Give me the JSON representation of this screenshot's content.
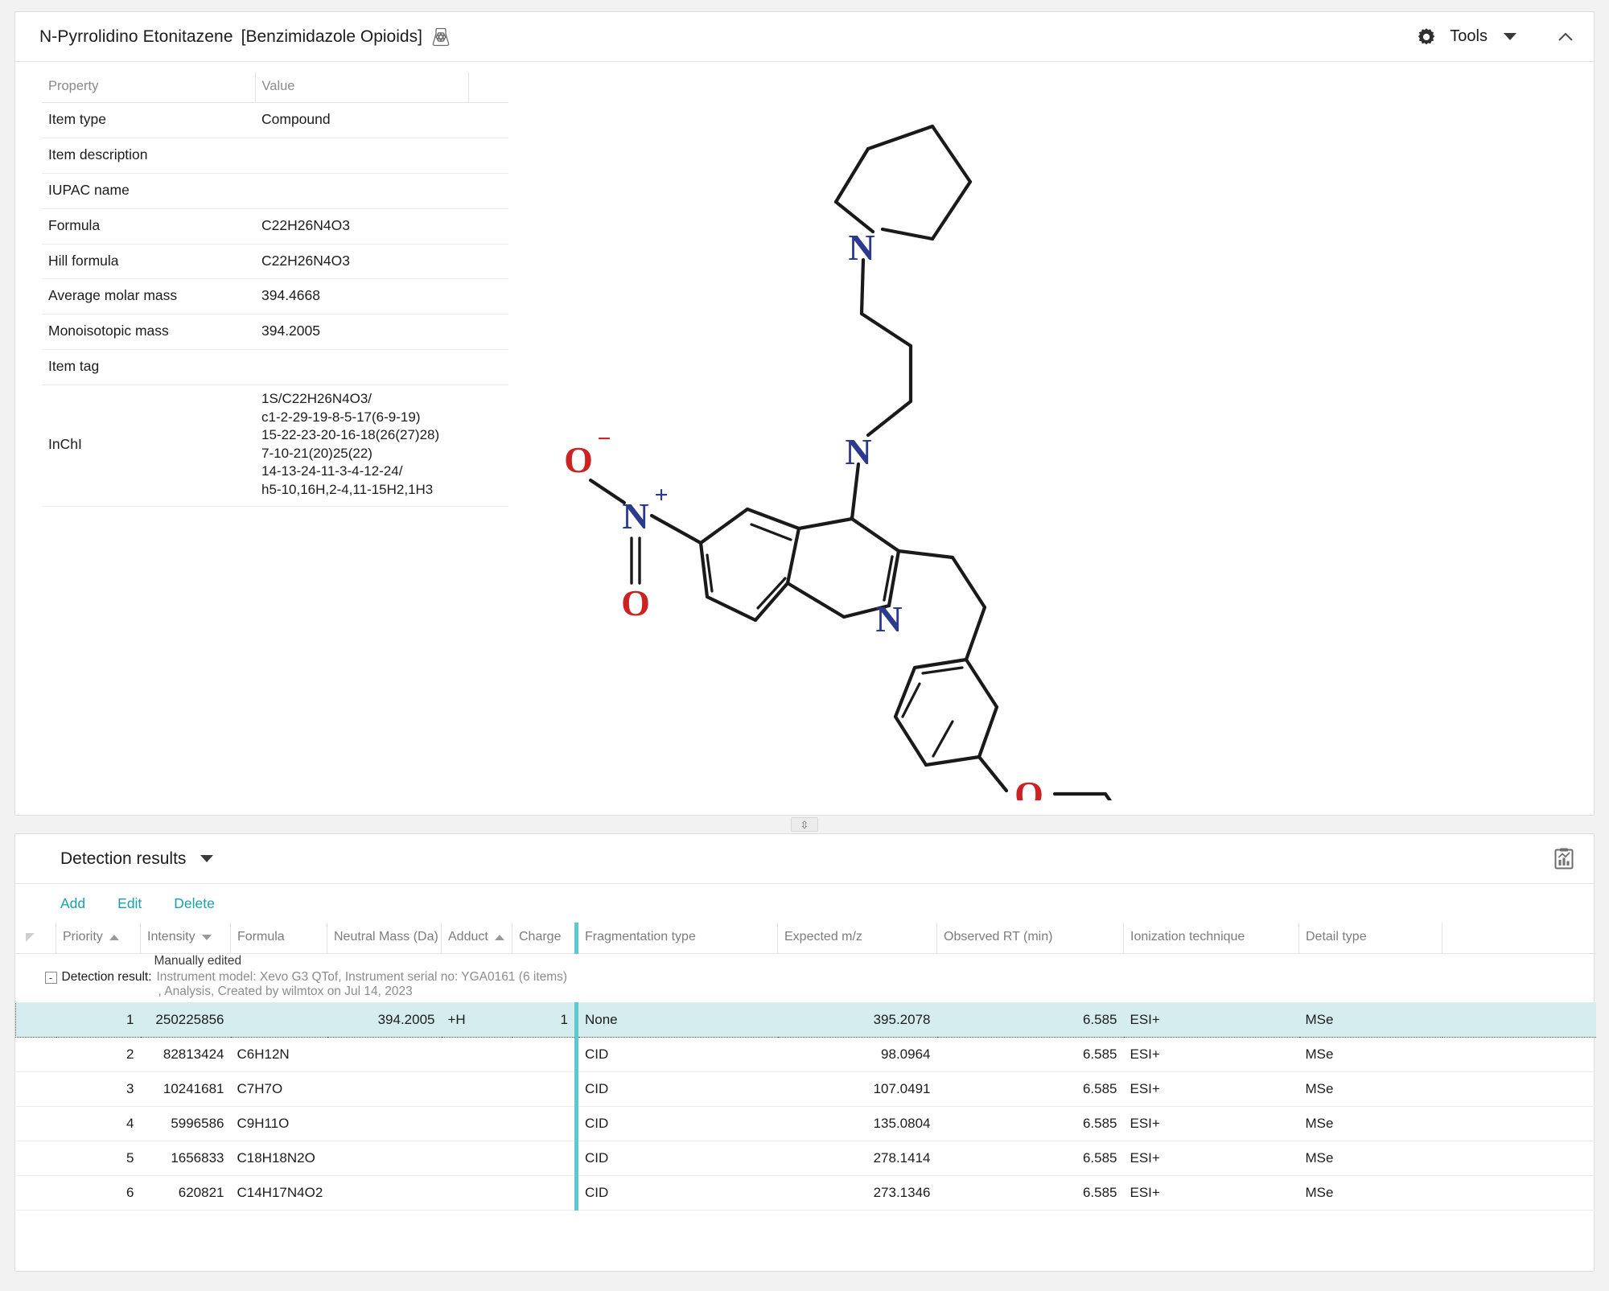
{
  "compound": {
    "name": "N-Pyrrolidino Etonitazene",
    "category": "[Benzimidazole Opioids]",
    "flask_icon": "molecule-flask-icon"
  },
  "top_toolbar": {
    "gear_icon": "gear-icon",
    "tools_label": "Tools",
    "caret_icon": "chevron-down-icon",
    "collapse_icon": "chevron-up-icon"
  },
  "properties": {
    "headers": [
      "Property",
      "Value",
      ""
    ],
    "rows": [
      {
        "property": "Item type",
        "value": "Compound"
      },
      {
        "property": "Item description",
        "value": ""
      },
      {
        "property": "IUPAC name",
        "value": ""
      },
      {
        "property": "Formula",
        "value": "C22H26N4O3"
      },
      {
        "property": "Hill formula",
        "value": "C22H26N4O3"
      },
      {
        "property": "Average molar mass",
        "value": "394.4668"
      },
      {
        "property": "Monoisotopic mass",
        "value": "394.2005"
      },
      {
        "property": "Item tag",
        "value": ""
      },
      {
        "property": "InChI",
        "value": "1S/C22H26N4O3/\nc1-2-29-19-8-5-17(6-9-19)\n15-22-23-20-16-18(26(27)28)\n7-10-21(20)25(22)\n14-13-24-11-3-4-12-24/\nh5-10,16H,2-4,11-15H2,1H3"
      }
    ]
  },
  "structure": {
    "atom_labels": [
      "N",
      "N",
      "N",
      "O",
      "O",
      "O"
    ],
    "charges": [
      "-",
      "+"
    ],
    "nitrogen_color": "#2b3a8f",
    "oxygen_color": "#cc2222",
    "bond_color": "#1a1a1a"
  },
  "splitter": {
    "handle_icon": "splitter-handle-icon"
  },
  "detection": {
    "title": "Detection results",
    "title_caret_icon": "chevron-down-icon",
    "chart_icon": "chart-report-icon",
    "toolbar": [
      {
        "label": "Add",
        "name": "add-button"
      },
      {
        "label": "Edit",
        "name": "edit-button"
      },
      {
        "label": "Delete",
        "name": "delete-button"
      }
    ],
    "columns": [
      {
        "label": "",
        "name": "row-selector-column",
        "sort": ""
      },
      {
        "label": "Priority",
        "name": "priority-column",
        "sort": "asc"
      },
      {
        "label": "Intensity",
        "name": "intensity-column",
        "sort": "desc"
      },
      {
        "label": "Formula",
        "name": "formula-column",
        "sort": ""
      },
      {
        "label": "Neutral Mass (Da)",
        "name": "neutral-mass-column",
        "sort": ""
      },
      {
        "label": "Adduct",
        "name": "adduct-column",
        "sort": "asc"
      },
      {
        "label": "Charge",
        "name": "charge-column",
        "sort": ""
      },
      {
        "label": "Fragmentation type",
        "name": "fragmentation-type-column",
        "sort": ""
      },
      {
        "label": "Expected m/z",
        "name": "expected-mz-column",
        "sort": ""
      },
      {
        "label": "Observed RT (min)",
        "name": "observed-rt-column",
        "sort": ""
      },
      {
        "label": "Ionization technique",
        "name": "ionization-technique-column",
        "sort": ""
      },
      {
        "label": "Detail type",
        "name": "detail-type-column",
        "sort": ""
      },
      {
        "label": "",
        "name": "trailing-column",
        "sort": ""
      }
    ],
    "group": {
      "manually_edited": "Manually edited",
      "label": "Detection result:",
      "meta_line1": "Instrument model: Xevo G3 QTof, Instrument serial no: YGA0161 (6 items)",
      "meta_line2": ", Analysis, Created by wilmtox on Jul 14, 2023",
      "expander": "-"
    },
    "rows": [
      {
        "priority": "1",
        "intensity": "250225856",
        "formula": "",
        "neutral_mass": "394.2005",
        "adduct": "+H",
        "charge": "1",
        "fragmentation": "None",
        "expected_mz": "395.2078",
        "observed_rt": "6.585",
        "ionization": "ESI+",
        "detail_type": "MSe",
        "selected": true
      },
      {
        "priority": "2",
        "intensity": "82813424",
        "formula": "C6H12N",
        "neutral_mass": "",
        "adduct": "",
        "charge": "",
        "fragmentation": "CID",
        "expected_mz": "98.0964",
        "observed_rt": "6.585",
        "ionization": "ESI+",
        "detail_type": "MSe",
        "selected": false
      },
      {
        "priority": "3",
        "intensity": "10241681",
        "formula": "C7H7O",
        "neutral_mass": "",
        "adduct": "",
        "charge": "",
        "fragmentation": "CID",
        "expected_mz": "107.0491",
        "observed_rt": "6.585",
        "ionization": "ESI+",
        "detail_type": "MSe",
        "selected": false
      },
      {
        "priority": "4",
        "intensity": "5996586",
        "formula": "C9H11O",
        "neutral_mass": "",
        "adduct": "",
        "charge": "",
        "fragmentation": "CID",
        "expected_mz": "135.0804",
        "observed_rt": "6.585",
        "ionization": "ESI+",
        "detail_type": "MSe",
        "selected": false
      },
      {
        "priority": "5",
        "intensity": "1656833",
        "formula": "C18H18N2O",
        "neutral_mass": "",
        "adduct": "",
        "charge": "",
        "fragmentation": "CID",
        "expected_mz": "278.1414",
        "observed_rt": "6.585",
        "ionization": "ESI+",
        "detail_type": "MSe",
        "selected": false
      },
      {
        "priority": "6",
        "intensity": "620821",
        "formula": "C14H17N4O2",
        "neutral_mass": "",
        "adduct": "",
        "charge": "",
        "fragmentation": "CID",
        "expected_mz": "273.1346",
        "observed_rt": "6.585",
        "ionization": "ESI+",
        "detail_type": "MSe",
        "selected": false
      }
    ]
  },
  "colors": {
    "accent_teal": "#1aa0a8",
    "selection_blue": "#d6edf0",
    "frag_bar": "#5ec8cd"
  }
}
